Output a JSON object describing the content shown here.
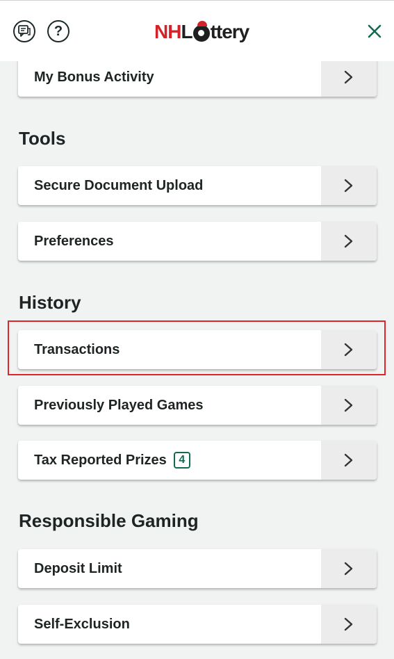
{
  "header": {
    "chat_icon": "chat-bubble-icon",
    "help_icon_label": "?",
    "logo": {
      "part1": "NH",
      "part2": "L",
      "part3": "ttery"
    },
    "close_icon": "close-icon"
  },
  "menu": {
    "bonus": {
      "label": "My Bonus Activity"
    },
    "tools": {
      "title": "Tools",
      "items": [
        {
          "label": "Secure Document Upload"
        },
        {
          "label": "Preferences"
        }
      ]
    },
    "history": {
      "title": "History",
      "items": [
        {
          "label": "Transactions"
        },
        {
          "label": "Previously Played Games"
        },
        {
          "label": "Tax Reported Prizes",
          "badge": "4"
        }
      ]
    },
    "responsible": {
      "title": "Responsible Gaming",
      "items": [
        {
          "label": "Deposit Limit"
        },
        {
          "label": "Self-Exclusion"
        }
      ]
    }
  },
  "colors": {
    "accent_green": "#0f6b52",
    "logo_red": "#d2232a",
    "highlight_red": "#e0242a"
  }
}
